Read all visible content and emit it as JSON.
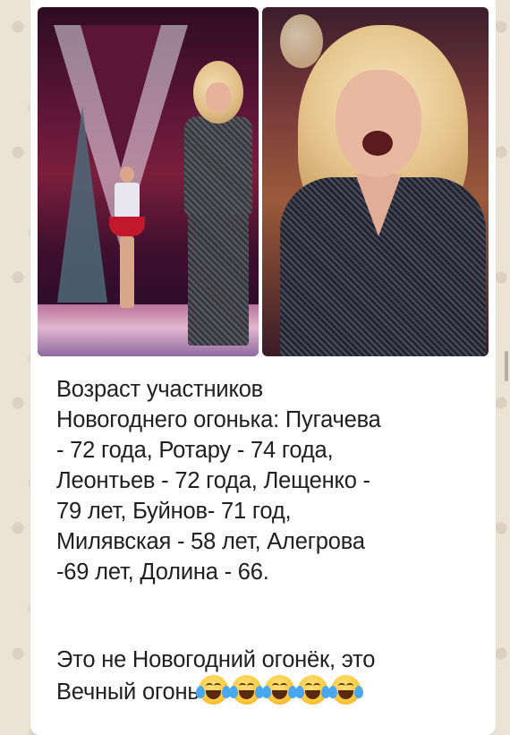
{
  "message": {
    "images": [
      {
        "name": "photo-left",
        "description_icon": "stage-performance-photo"
      },
      {
        "name": "photo-right",
        "description_icon": "singer-closeup-photo"
      }
    ],
    "caption_paragraph_1": "Возраст участников\nНовогоднего огонька: Пугачева\n- 72 года, Ротару - 74 года,\nЛеонтьев - 72 года, Лещенко -\n79 лет, Буйнов- 71 год,\nМилявская - 58 лет, Алегрова\n-69 лет, Долина - 66.",
    "caption_paragraph_2_line_1": "Это не Новогодний огонёк, это",
    "caption_paragraph_2_line_2": "Вечный огонь",
    "emoji_name": "face-with-tears-of-joy-icon",
    "emoji_count": 5
  },
  "colors": {
    "chat_background": "#ece3d6",
    "bubble_background": "#ffffff",
    "text": "#202020"
  }
}
